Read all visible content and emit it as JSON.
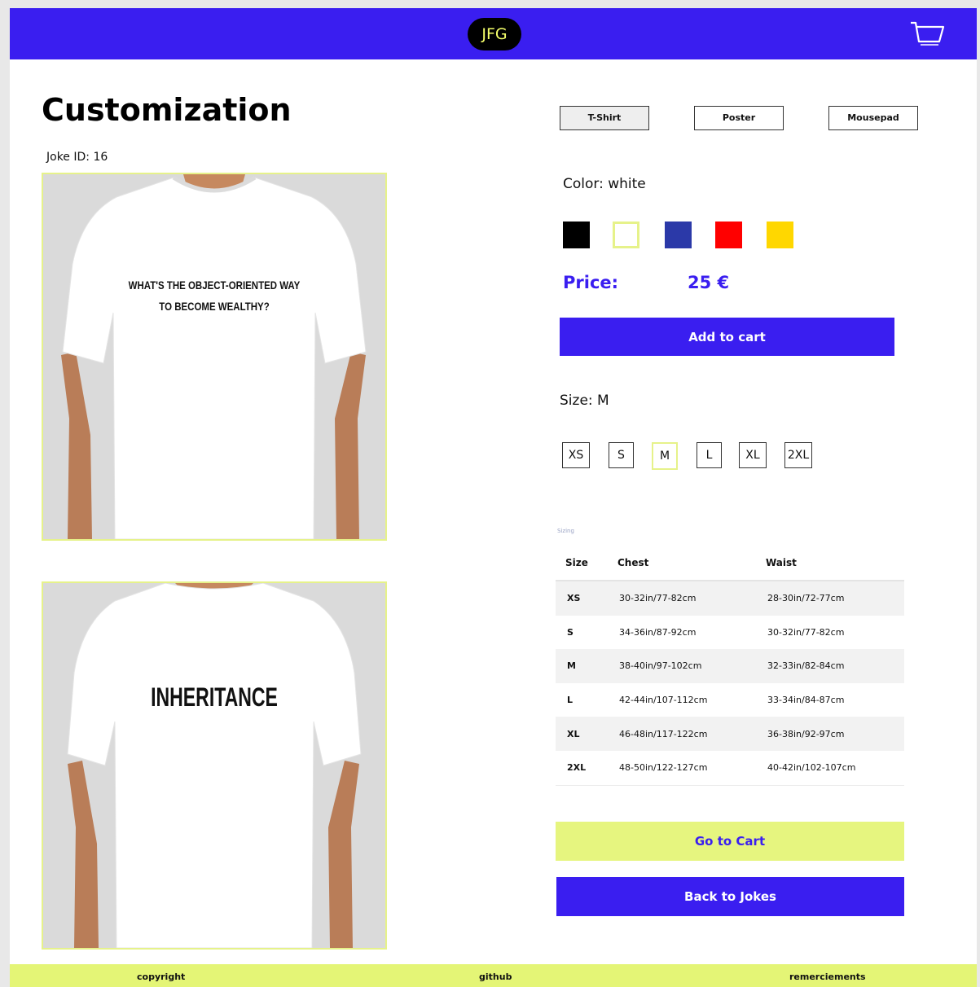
{
  "header": {
    "logo": "JFG",
    "cart_icon": "cart-icon"
  },
  "page": {
    "title": "Customization",
    "joke_id": "Joke ID: 16"
  },
  "shirt": {
    "front_text_line1": "WHAT'S THE OBJECT-ORIENTED WAY",
    "front_text_line2": "TO BECOME WEALTHY?",
    "back_text": "INHERITANCE",
    "color": "#ffffff"
  },
  "products": [
    {
      "label": "T-Shirt",
      "active": true
    },
    {
      "label": "Poster",
      "active": false
    },
    {
      "label": "Mousepad",
      "active": false
    }
  ],
  "color": {
    "label": "Color: white",
    "swatches": [
      {
        "name": "black",
        "hex": "#000000"
      },
      {
        "name": "white",
        "hex": "#ffffff",
        "selected": true
      },
      {
        "name": "blue",
        "hex": "#2b39a8"
      },
      {
        "name": "red",
        "hex": "#ff0000"
      },
      {
        "name": "yellow",
        "hex": "#ffd700"
      }
    ]
  },
  "price": {
    "label": "Price:",
    "value": "25 €"
  },
  "actions": {
    "add_to_cart": "Add to cart",
    "go_to_cart": "Go to Cart",
    "back_to_jokes": "Back to Jokes"
  },
  "size": {
    "label": "Size: M",
    "options": [
      "XS",
      "S",
      "M",
      "L",
      "XL",
      "2XL"
    ],
    "selected": "M"
  },
  "size_chart": {
    "caption": "Sizing",
    "headers": [
      "Size",
      "Chest",
      "Waist"
    ],
    "rows": [
      [
        "XS",
        "30-32in/77-82cm",
        "28-30in/72-77cm"
      ],
      [
        "S",
        "34-36in/87-92cm",
        "30-32in/77-82cm"
      ],
      [
        "M",
        "38-40in/97-102cm",
        "32-33in/82-84cm"
      ],
      [
        "L",
        "42-44in/107-112cm",
        "33-34in/84-87cm"
      ],
      [
        "XL",
        "46-48in/117-122cm",
        "36-38in/92-97cm"
      ],
      [
        "2XL",
        "48-50in/122-127cm",
        "40-42in/102-107cm"
      ]
    ]
  },
  "footer": {
    "copyright": "copyright",
    "github": "github",
    "thanks": "remerciements"
  },
  "colors": {
    "accent_blue": "#3a1ef0",
    "accent_yellow": "#e4f576",
    "shirt_border": "#e6f28a"
  }
}
